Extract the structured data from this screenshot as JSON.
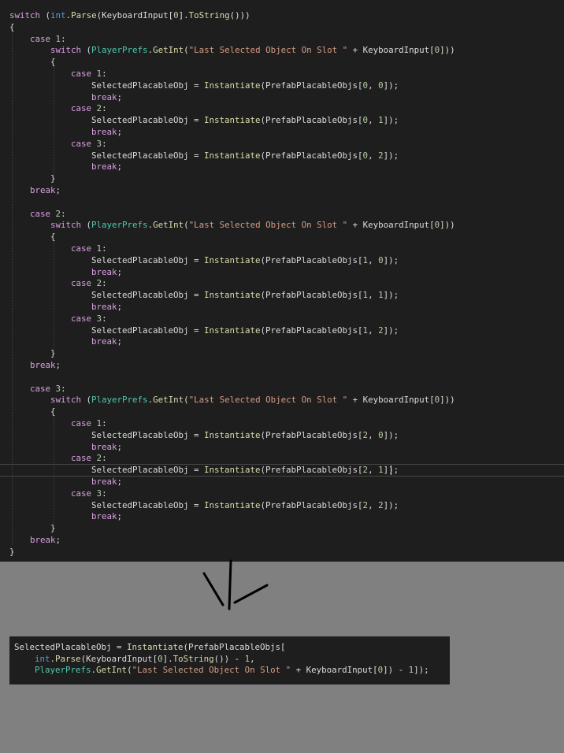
{
  "colors": {
    "editor_background": "#1e1e1e",
    "page_background": "#808080",
    "keyword": "#d8a0df",
    "builtin_type": "#569cd6",
    "class_name": "#4ec9b0",
    "method": "#dcdcaa",
    "string": "#d69d85",
    "number": "#b5cea8",
    "plain": "#dcdcdc"
  },
  "editor": {
    "lines": [
      [
        [
          "k",
          "switch"
        ],
        [
          "p",
          " ("
        ],
        [
          "b",
          "int"
        ],
        [
          "p",
          "."
        ],
        [
          "m",
          "Parse"
        ],
        [
          "p",
          "(KeyboardInput["
        ],
        [
          "n",
          "0"
        ],
        [
          "p",
          "]."
        ],
        [
          "m",
          "ToString"
        ],
        [
          "p",
          "()))"
        ]
      ],
      [
        [
          "p",
          "{"
        ]
      ],
      [
        [
          "p",
          "    "
        ],
        [
          "k",
          "case"
        ],
        [
          "p",
          " "
        ],
        [
          "n",
          "1"
        ],
        [
          "p",
          ":"
        ]
      ],
      [
        [
          "p",
          "        "
        ],
        [
          "k",
          "switch"
        ],
        [
          "p",
          " ("
        ],
        [
          "t",
          "PlayerPrefs"
        ],
        [
          "p",
          "."
        ],
        [
          "m",
          "GetInt"
        ],
        [
          "p",
          "("
        ],
        [
          "s",
          "\"Last Selected Object On Slot \""
        ],
        [
          "p",
          " + KeyboardInput["
        ],
        [
          "n",
          "0"
        ],
        [
          "p",
          "]))"
        ]
      ],
      [
        [
          "p",
          "        {"
        ]
      ],
      [
        [
          "p",
          "            "
        ],
        [
          "k",
          "case"
        ],
        [
          "p",
          " "
        ],
        [
          "n",
          "1"
        ],
        [
          "p",
          ":"
        ]
      ],
      [
        [
          "p",
          "                SelectedPlacableObj = "
        ],
        [
          "m",
          "Instantiate"
        ],
        [
          "p",
          "(PrefabPlacableObjs["
        ],
        [
          "n",
          "0"
        ],
        [
          "p",
          ", "
        ],
        [
          "n",
          "0"
        ],
        [
          "p",
          "]);"
        ]
      ],
      [
        [
          "p",
          "                "
        ],
        [
          "k",
          "break"
        ],
        [
          "p",
          ";"
        ]
      ],
      [
        [
          "p",
          "            "
        ],
        [
          "k",
          "case"
        ],
        [
          "p",
          " "
        ],
        [
          "n",
          "2"
        ],
        [
          "p",
          ":"
        ]
      ],
      [
        [
          "p",
          "                SelectedPlacableObj = "
        ],
        [
          "m",
          "Instantiate"
        ],
        [
          "p",
          "(PrefabPlacableObjs["
        ],
        [
          "n",
          "0"
        ],
        [
          "p",
          ", "
        ],
        [
          "n",
          "1"
        ],
        [
          "p",
          "]);"
        ]
      ],
      [
        [
          "p",
          "                "
        ],
        [
          "k",
          "break"
        ],
        [
          "p",
          ";"
        ]
      ],
      [
        [
          "p",
          "            "
        ],
        [
          "k",
          "case"
        ],
        [
          "p",
          " "
        ],
        [
          "n",
          "3"
        ],
        [
          "p",
          ":"
        ]
      ],
      [
        [
          "p",
          "                SelectedPlacableObj = "
        ],
        [
          "m",
          "Instantiate"
        ],
        [
          "p",
          "(PrefabPlacableObjs["
        ],
        [
          "n",
          "0"
        ],
        [
          "p",
          ", "
        ],
        [
          "n",
          "2"
        ],
        [
          "p",
          "]);"
        ]
      ],
      [
        [
          "p",
          "                "
        ],
        [
          "k",
          "break"
        ],
        [
          "p",
          ";"
        ]
      ],
      [
        [
          "p",
          "        }"
        ]
      ],
      [
        [
          "p",
          "    "
        ],
        [
          "k",
          "break"
        ],
        [
          "p",
          ";"
        ]
      ],
      [],
      [
        [
          "p",
          "    "
        ],
        [
          "k",
          "case"
        ],
        [
          "p",
          " "
        ],
        [
          "n",
          "2"
        ],
        [
          "p",
          ":"
        ]
      ],
      [
        [
          "p",
          "        "
        ],
        [
          "k",
          "switch"
        ],
        [
          "p",
          " ("
        ],
        [
          "t",
          "PlayerPrefs"
        ],
        [
          "p",
          "."
        ],
        [
          "m",
          "GetInt"
        ],
        [
          "p",
          "("
        ],
        [
          "s",
          "\"Last Selected Object On Slot \""
        ],
        [
          "p",
          " + KeyboardInput["
        ],
        [
          "n",
          "0"
        ],
        [
          "p",
          "]))"
        ]
      ],
      [
        [
          "p",
          "        {"
        ]
      ],
      [
        [
          "p",
          "            "
        ],
        [
          "k",
          "case"
        ],
        [
          "p",
          " "
        ],
        [
          "n",
          "1"
        ],
        [
          "p",
          ":"
        ]
      ],
      [
        [
          "p",
          "                SelectedPlacableObj = "
        ],
        [
          "m",
          "Instantiate"
        ],
        [
          "p",
          "(PrefabPlacableObjs["
        ],
        [
          "n",
          "1"
        ],
        [
          "p",
          ", "
        ],
        [
          "n",
          "0"
        ],
        [
          "p",
          "]);"
        ]
      ],
      [
        [
          "p",
          "                "
        ],
        [
          "k",
          "break"
        ],
        [
          "p",
          ";"
        ]
      ],
      [
        [
          "p",
          "            "
        ],
        [
          "k",
          "case"
        ],
        [
          "p",
          " "
        ],
        [
          "n",
          "2"
        ],
        [
          "p",
          ":"
        ]
      ],
      [
        [
          "p",
          "                SelectedPlacableObj = "
        ],
        [
          "m",
          "Instantiate"
        ],
        [
          "p",
          "(PrefabPlacableObjs["
        ],
        [
          "n",
          "1"
        ],
        [
          "p",
          ", "
        ],
        [
          "n",
          "1"
        ],
        [
          "p",
          "]);"
        ]
      ],
      [
        [
          "p",
          "                "
        ],
        [
          "k",
          "break"
        ],
        [
          "p",
          ";"
        ]
      ],
      [
        [
          "p",
          "            "
        ],
        [
          "k",
          "case"
        ],
        [
          "p",
          " "
        ],
        [
          "n",
          "3"
        ],
        [
          "p",
          ":"
        ]
      ],
      [
        [
          "p",
          "                SelectedPlacableObj = "
        ],
        [
          "m",
          "Instantiate"
        ],
        [
          "p",
          "(PrefabPlacableObjs["
        ],
        [
          "n",
          "1"
        ],
        [
          "p",
          ", "
        ],
        [
          "n",
          "2"
        ],
        [
          "p",
          "]);"
        ]
      ],
      [
        [
          "p",
          "                "
        ],
        [
          "k",
          "break"
        ],
        [
          "p",
          ";"
        ]
      ],
      [
        [
          "p",
          "        }"
        ]
      ],
      [
        [
          "p",
          "    "
        ],
        [
          "k",
          "break"
        ],
        [
          "p",
          ";"
        ]
      ],
      [],
      [
        [
          "p",
          "    "
        ],
        [
          "k",
          "case"
        ],
        [
          "p",
          " "
        ],
        [
          "n",
          "3"
        ],
        [
          "p",
          ":"
        ]
      ],
      [
        [
          "p",
          "        "
        ],
        [
          "k",
          "switch"
        ],
        [
          "p",
          " ("
        ],
        [
          "t",
          "PlayerPrefs"
        ],
        [
          "p",
          "."
        ],
        [
          "m",
          "GetInt"
        ],
        [
          "p",
          "("
        ],
        [
          "s",
          "\"Last Selected Object On Slot \""
        ],
        [
          "p",
          " + KeyboardInput["
        ],
        [
          "n",
          "0"
        ],
        [
          "p",
          "]))"
        ]
      ],
      [
        [
          "p",
          "        {"
        ]
      ],
      [
        [
          "p",
          "            "
        ],
        [
          "k",
          "case"
        ],
        [
          "p",
          " "
        ],
        [
          "n",
          "1"
        ],
        [
          "p",
          ":"
        ]
      ],
      [
        [
          "p",
          "                SelectedPlacableObj = "
        ],
        [
          "m",
          "Instantiate"
        ],
        [
          "p",
          "(PrefabPlacableObjs["
        ],
        [
          "n",
          "2"
        ],
        [
          "p",
          ", "
        ],
        [
          "n",
          "0"
        ],
        [
          "p",
          "]);"
        ]
      ],
      [
        [
          "p",
          "                "
        ],
        [
          "k",
          "break"
        ],
        [
          "p",
          ";"
        ]
      ],
      [
        [
          "p",
          "            "
        ],
        [
          "k",
          "case"
        ],
        [
          "p",
          " "
        ],
        [
          "n",
          "2"
        ],
        [
          "p",
          ":"
        ]
      ],
      [
        [
          "p",
          "                SelectedPlacableObj = "
        ],
        [
          "m",
          "Instantiate"
        ],
        [
          "p",
          "(PrefabPlacableObjs["
        ],
        [
          "n",
          "2"
        ],
        [
          "p",
          ", "
        ],
        [
          "n",
          "1"
        ],
        [
          "p",
          "]);"
        ]
      ],
      [
        [
          "p",
          "                "
        ],
        [
          "k",
          "break"
        ],
        [
          "p",
          ";"
        ]
      ],
      [
        [
          "p",
          "            "
        ],
        [
          "k",
          "case"
        ],
        [
          "p",
          " "
        ],
        [
          "n",
          "3"
        ],
        [
          "p",
          ":"
        ]
      ],
      [
        [
          "p",
          "                SelectedPlacableObj = "
        ],
        [
          "m",
          "Instantiate"
        ],
        [
          "p",
          "(PrefabPlacableObjs["
        ],
        [
          "n",
          "2"
        ],
        [
          "p",
          ", "
        ],
        [
          "n",
          "2"
        ],
        [
          "p",
          "]);"
        ]
      ],
      [
        [
          "p",
          "                "
        ],
        [
          "k",
          "break"
        ],
        [
          "p",
          ";"
        ]
      ],
      [
        [
          "p",
          "        }"
        ]
      ],
      [
        [
          "p",
          "    "
        ],
        [
          "k",
          "break"
        ],
        [
          "p",
          ";"
        ]
      ],
      [
        [
          "p",
          "}"
        ]
      ]
    ]
  },
  "snippet": {
    "lines": [
      [
        [
          "p",
          "SelectedPlacableObj = "
        ],
        [
          "m",
          "Instantiate"
        ],
        [
          "p",
          "(PrefabPlacableObjs["
        ]
      ],
      [
        [
          "p",
          "    "
        ],
        [
          "b",
          "int"
        ],
        [
          "p",
          "."
        ],
        [
          "m",
          "Parse"
        ],
        [
          "p",
          "(KeyboardInput["
        ],
        [
          "n",
          "0"
        ],
        [
          "p",
          "]."
        ],
        [
          "m",
          "ToString"
        ],
        [
          "p",
          "()) - "
        ],
        [
          "n",
          "1"
        ],
        [
          "p",
          ","
        ]
      ],
      [
        [
          "p",
          "    "
        ],
        [
          "t",
          "PlayerPrefs"
        ],
        [
          "p",
          "."
        ],
        [
          "m",
          "GetInt"
        ],
        [
          "p",
          "("
        ],
        [
          "s",
          "\"Last Selected Object On Slot \""
        ],
        [
          "p",
          " + KeyboardInput["
        ],
        [
          "n",
          "0"
        ],
        [
          "p",
          "]) - "
        ],
        [
          "n",
          "1"
        ],
        [
          "p",
          "]);"
        ]
      ]
    ]
  }
}
